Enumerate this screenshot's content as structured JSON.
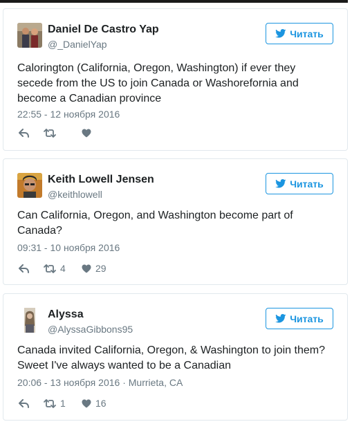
{
  "follow_label": "Читать",
  "tweets": [
    {
      "name": "Daniel De Castro Yap",
      "handle": "@_DanielYap",
      "text": "Calorington (California, Oregon, Washington) if ever they secede from the US to join Canada or Washorefornia and become a Canadian province",
      "timestamp": "22:55 - 12 ноября 2016",
      "retweets": "",
      "likes": ""
    },
    {
      "name": "Keith Lowell Jensen",
      "handle": "@keithlowell",
      "text": "Can California, Oregon, and Washington become part of Canada?",
      "timestamp": "09:31 - 10 ноября 2016",
      "retweets": "4",
      "likes": "29"
    },
    {
      "name": "Alyssa",
      "handle": "@AlyssaGibbons95",
      "text": "Canada invited California, Oregon, & Washington to join them? Sweet I've always wanted to be a Canadian",
      "timestamp": "20:06 - 13 ноября 2016 · Murrieta, CA",
      "retweets": "1",
      "likes": "16"
    }
  ],
  "colors": {
    "accent": "#1b95e0",
    "muted": "#697882",
    "text": "#1c2022",
    "border": "#e1e8ed"
  },
  "icons": {
    "follow": "twitter-bird-icon",
    "reply": "reply-icon",
    "retweet": "retweet-icon",
    "like": "heart-icon"
  }
}
